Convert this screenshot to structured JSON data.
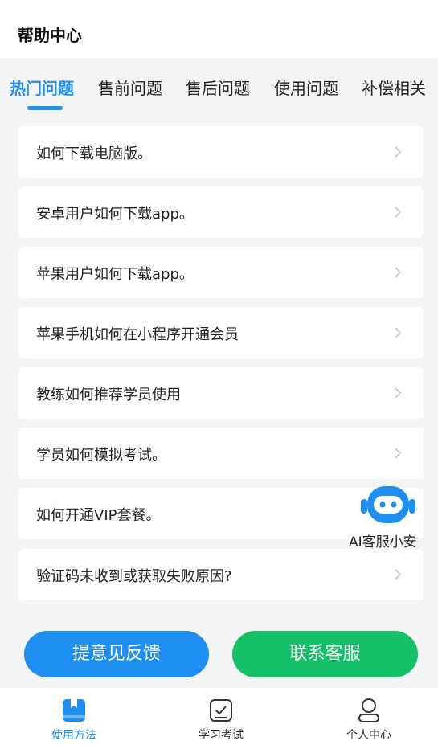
{
  "header": {
    "title": "帮助中心"
  },
  "tabs": [
    {
      "label": "热门问题",
      "active": true
    },
    {
      "label": "售前问题",
      "active": false
    },
    {
      "label": "售后问题",
      "active": false
    },
    {
      "label": "使用问题",
      "active": false
    },
    {
      "label": "补偿相关",
      "active": false
    }
  ],
  "questions": [
    "如何下载电脑版。",
    "安卓用户如何下载app。",
    "苹果用户如何下载app。",
    "苹果手机如何在小程序开通会员",
    "教练如何推荐学员使用",
    "学员如何模拟考试。",
    "如何开通VIP套餐。",
    "验证码未收到或获取失败原因?"
  ],
  "ai_assistant": {
    "label": "AI客服小安",
    "icon": "robot-icon"
  },
  "actions": {
    "feedback": "提意见反馈",
    "contact": "联系客服"
  },
  "bottom_nav": [
    {
      "label": "使用方法",
      "icon": "book-icon",
      "active": true
    },
    {
      "label": "学习考试",
      "icon": "checklist-icon",
      "active": false
    },
    {
      "label": "个人中心",
      "icon": "person-icon",
      "active": false
    }
  ],
  "colors": {
    "primary": "#1e8ef0",
    "success": "#15c068",
    "background": "#f4f5f7"
  }
}
